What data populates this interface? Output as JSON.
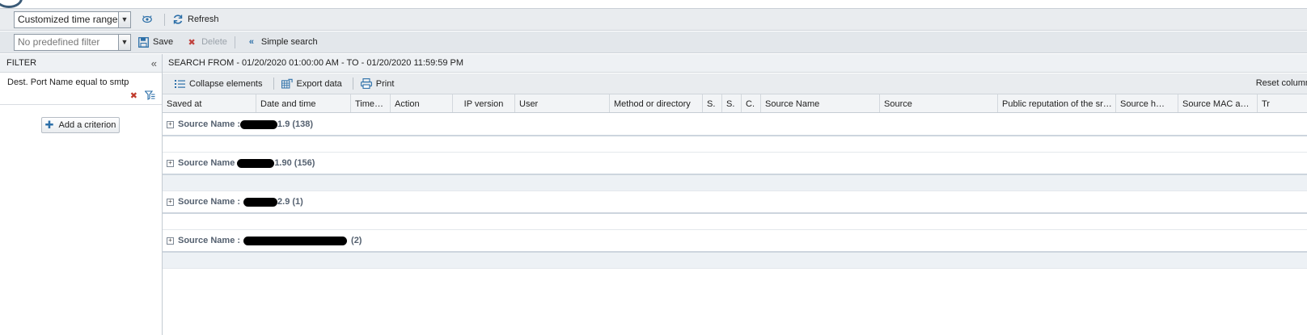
{
  "toolbar1": {
    "time_range": "Customized time range",
    "refresh_label": "Refresh"
  },
  "toolbar2": {
    "filter_placeholder": "No predefined filter",
    "save_label": "Save",
    "delete_label": "Delete",
    "simple_search_label": "Simple search"
  },
  "filter_panel": {
    "title": "FILTER",
    "criterion_prefix": "Dest. Port Name",
    "criterion_bold": "equal to smtp",
    "add_criterion_label": "Add a criterion"
  },
  "search": {
    "heading": "SEARCH FROM - 01/20/2020 01:00:00 AM - TO - 01/20/2020 11:59:59 PM"
  },
  "main_toolbar": {
    "collapse_label": "Collapse elements",
    "export_label": "Export data",
    "print_label": "Print",
    "reset_label": "Reset column"
  },
  "columns": [
    "Saved at",
    "Date and time",
    "Time…",
    "Action",
    "IP version",
    "User",
    "Method or directory",
    "S.",
    "S.",
    "C.",
    "Source Name",
    "Source",
    "Public reputation of the sr…",
    "Source h…",
    "Source MAC a…",
    "Tr"
  ],
  "groups": [
    {
      "label": "Source Name :",
      "suffix": "1.9 (138)"
    },
    {
      "label": "Source Name",
      "suffix": "1.90 (156)"
    },
    {
      "label": "Source Name :",
      "suffix": "2.9 (1)"
    },
    {
      "label": "Source Name :",
      "suffix": "(2)"
    }
  ],
  "icons": {
    "time_range_settings": "gear-eye-icon",
    "refresh": "refresh-icon",
    "save": "floppy-disk-icon",
    "delete": "red-x-icon",
    "simple_search": "double-chevron-left-icon",
    "collapse_panel": "double-chevron-left-icon",
    "remove_criterion": "red-x-icon",
    "edit_criterion": "filter-edit-icon",
    "add": "plus-icon",
    "collapse_elements": "list-icon",
    "export": "export-grid-icon",
    "print": "printer-icon",
    "expand_group": "plus-box-icon"
  },
  "colors": {
    "accent_blue": "#2c6fa8",
    "delete_red": "#c0433f",
    "toolbar_bg": "#e9ecef",
    "group_separator": "#cdd5de"
  }
}
